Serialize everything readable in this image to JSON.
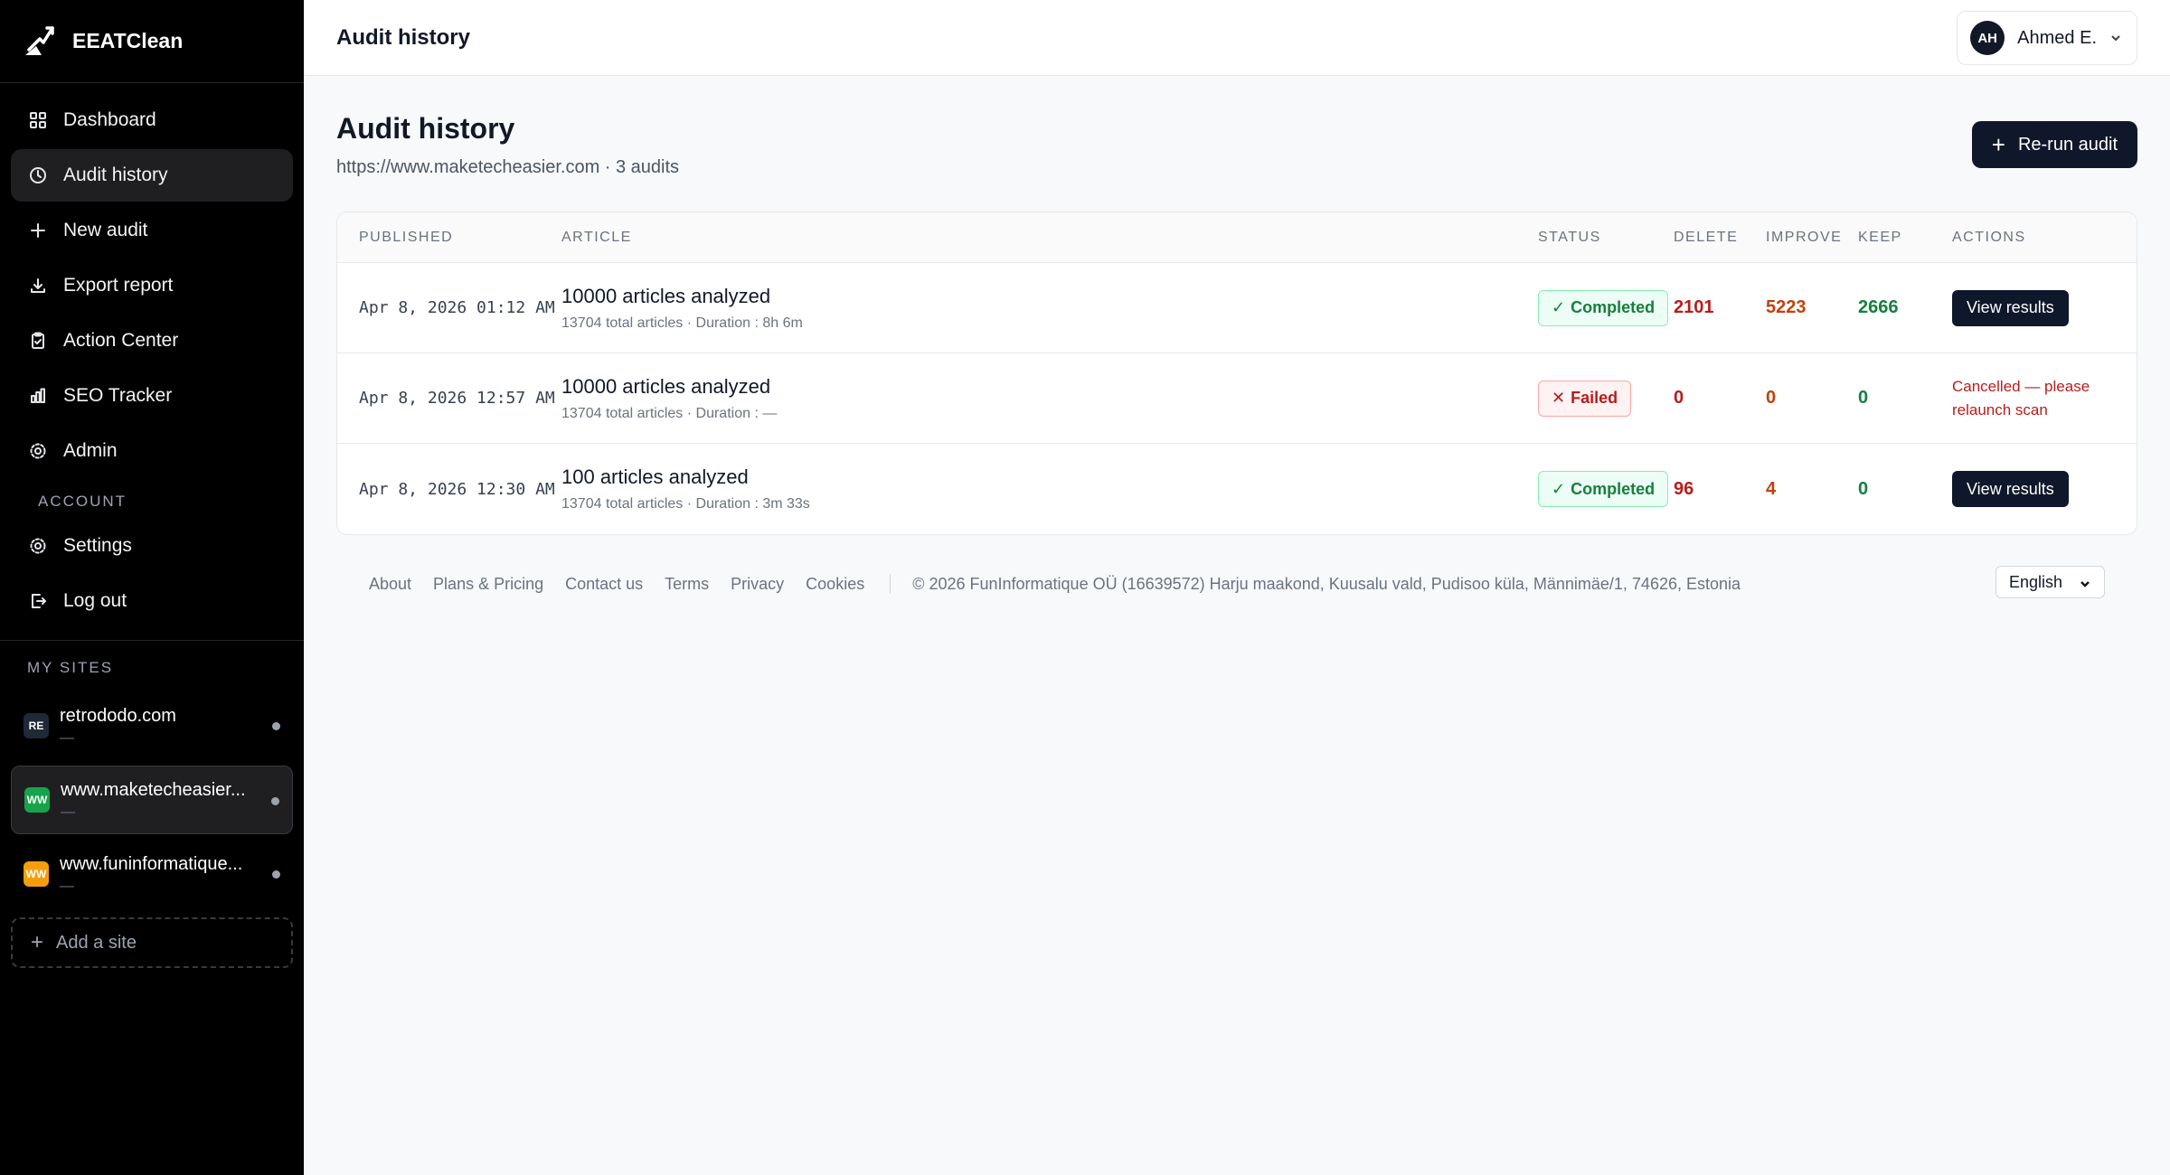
{
  "brand": {
    "name": "EEATClean"
  },
  "sidebar": {
    "nav": [
      {
        "label": "Dashboard",
        "icon": "grid-icon"
      },
      {
        "label": "Audit history",
        "icon": "clock-icon",
        "active": true
      },
      {
        "label": "New audit",
        "icon": "plus-icon"
      },
      {
        "label": "Export report",
        "icon": "download-icon"
      },
      {
        "label": "Action Center",
        "icon": "clipboard-icon"
      },
      {
        "label": "SEO Tracker",
        "icon": "bar-chart-icon"
      },
      {
        "label": "Admin",
        "icon": "gear-icon"
      }
    ],
    "account_label": "ACCOUNT",
    "account": [
      {
        "label": "Settings",
        "icon": "gear-icon"
      },
      {
        "label": "Log out",
        "icon": "logout-icon"
      }
    ],
    "sites_label": "MY SITES",
    "sites": [
      {
        "badge": "RE",
        "name": "retrododo.com",
        "sub": "—",
        "color": "#1f2937"
      },
      {
        "badge": "WW",
        "name": "www.maketecheasier...",
        "sub": "—",
        "color": "#16a34a"
      },
      {
        "badge": "WW",
        "name": "www.funinformatique...",
        "sub": "—",
        "color": "#f59e0b"
      }
    ],
    "add_site": "Add a site"
  },
  "topbar": {
    "title": "Audit history",
    "user_initials": "AH",
    "user_name": "Ahmed E."
  },
  "main": {
    "title": "Audit history",
    "subtitle": "https://www.maketecheasier.com · 3 audits",
    "rerun_label": "Re-run audit",
    "columns": [
      "PUBLISHED",
      "ARTICLE",
      "STATUS",
      "DELETE",
      "IMPROVE",
      "KEEP",
      "ACTIONS"
    ],
    "rows": [
      {
        "published": "Apr 8, 2026 01:12 AM",
        "title": "10000 articles analyzed",
        "meta": "13704 total articles · Duration : 8h 6m",
        "status": "Completed",
        "delete": "2101",
        "improve": "5223",
        "keep": "2666",
        "action": "View results"
      },
      {
        "published": "Apr 8, 2026 12:57 AM",
        "title": "10000 articles analyzed",
        "meta": "13704 total articles · Duration : —",
        "status": "Failed",
        "delete": "0",
        "improve": "0",
        "keep": "0",
        "action": "Cancelled — please relaunch scan"
      },
      {
        "published": "Apr 8, 2026 12:30 AM",
        "title": "100 articles analyzed",
        "meta": "13704 total articles · Duration : 3m 33s",
        "status": "Completed",
        "delete": "96",
        "improve": "4",
        "keep": "0",
        "action": "View results"
      }
    ]
  },
  "footer": {
    "links": [
      "About",
      "Plans & Pricing",
      "Contact us",
      "Terms",
      "Privacy",
      "Cookies"
    ],
    "copyright": "© 2026 FunInformatique OÜ (16639572) Harju maakond, Kuusalu vald, Pudisoo küla, Männimäe/1, 74626, Estonia",
    "language": "English"
  }
}
